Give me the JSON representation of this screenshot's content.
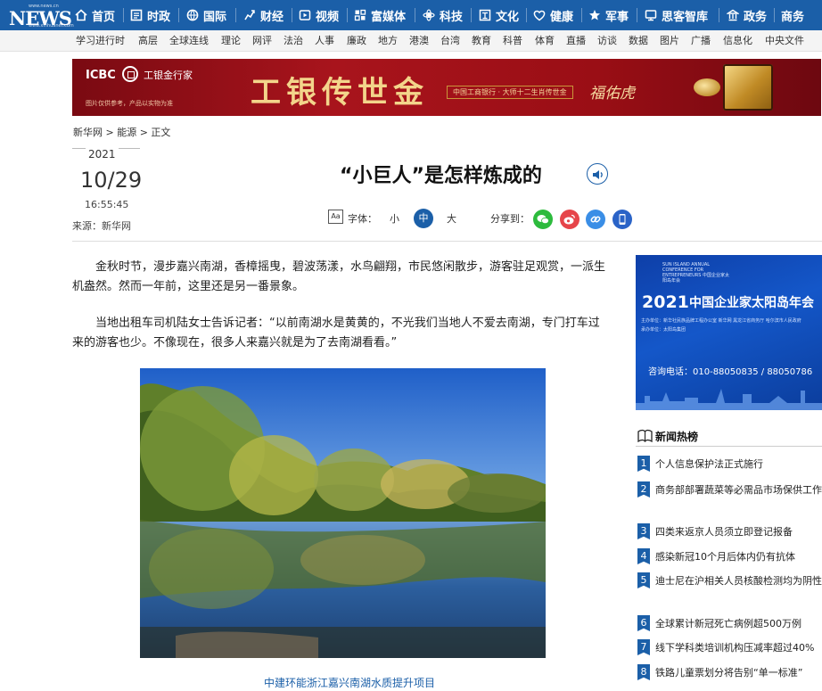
{
  "logo": {
    "latin": "NEWS",
    "cn": "新华网",
    "url": "www.news.cn",
    "url2": "www.xinhuanet.com"
  },
  "topnav": [
    {
      "label": "首页",
      "icon": "home-icon"
    },
    {
      "label": "时政",
      "icon": "politics-icon"
    },
    {
      "label": "国际",
      "icon": "globe-icon"
    },
    {
      "label": "财经",
      "icon": "finance-icon"
    },
    {
      "label": "视频",
      "icon": "video-icon"
    },
    {
      "label": "富媒体",
      "icon": "media-icon"
    },
    {
      "label": "科技",
      "icon": "tech-icon"
    },
    {
      "label": "文化",
      "icon": "culture-icon"
    },
    {
      "label": "健康",
      "icon": "health-icon"
    },
    {
      "label": "军事",
      "icon": "military-icon"
    },
    {
      "label": "思客智库",
      "icon": "thinktank-icon"
    },
    {
      "label": "政务",
      "icon": "government-icon"
    },
    {
      "label": "商务",
      "icon": ""
    }
  ],
  "subnav": [
    "学习进行时",
    "高层",
    "全球连线",
    "理论",
    "网评",
    "法治",
    "人事",
    "廉政",
    "地方",
    "港澳",
    "台湾",
    "教育",
    "科普",
    "体育",
    "直播",
    "访谈",
    "数据",
    "图片",
    "广播",
    "信息化",
    "中央文件"
  ],
  "banner": {
    "icbc": "ICBC",
    "bank": "工银金行家",
    "note": "图片仅供参考，产品以实物为准",
    "headline": "工银传世金",
    "slogan": "中国工商银行 · 大师十二生肖传世金",
    "signature": "福佑虎",
    "colors": {
      "bg": "#a8141c",
      "gold": "#f3d58b"
    }
  },
  "breadcrumb": "新华网 > 能源 > 正文",
  "date": {
    "year": "2021",
    "monthday": "10/29",
    "time": "16:55:45",
    "source": "来源：新华网"
  },
  "article": {
    "title": "“小巨人”是怎样炼成的",
    "fontsize_label": "字体：",
    "size_small": "小",
    "size_medium": "中",
    "size_large": "大",
    "share_label": "分享到：",
    "paragraphs": [
      "金秋时节，漫步嘉兴南湖，香樟摇曳，碧波荡漾，水鸟翩翔，市民悠闲散步，游客驻足观赏，一派生机盎然。然而一年前，这里还是另一番景象。",
      "当地出租车司机陆女士告诉记者：“以前南湖水是黄黄的，不光我们当地人不爱去南湖，专门打车过来的游客也少。不像现在，很多人来嘉兴就是为了去南湖看看。”"
    ],
    "photo_caption": "中建环能浙江嘉兴南湖水质提升项目"
  },
  "share_icons": [
    {
      "name": "wechat-icon",
      "color": "#2dbb3d"
    },
    {
      "name": "weibo-icon",
      "color": "#e6454a"
    },
    {
      "name": "link-icon",
      "color": "#3a8ee6"
    },
    {
      "name": "mobile-icon",
      "color": "#2a63c7"
    }
  ],
  "ad": {
    "small": "SUN ISLAND ANNUAL CONFERENCE FOR ENTREPRENEURS 中国企业家太阳岛年会",
    "year": "2021",
    "title": "中国企业家太阳岛年会",
    "line1": "主办单位：新华社民族品牌工程办公室 新华网 黑龙江省商务厅 哈尔滨市人民政府",
    "line2": "承办单位：太阳岛集团",
    "tel": "咨询电话：010-88050835 / 88050786"
  },
  "hotnews": {
    "title": "新闻热榜",
    "items": [
      {
        "num": "1",
        "text": "个人信息保护法正式施行"
      },
      {
        "num": "2",
        "text": "商务部部署蔬菜等必需品市场保供工作"
      },
      {
        "num": "3",
        "text": "四类来返京人员须立即登记报备"
      },
      {
        "num": "4",
        "text": "感染新冠10个月后体内仍有抗体"
      },
      {
        "num": "5",
        "text": "迪士尼在沪相关人员核酸检测均为阴性"
      },
      {
        "num": "6",
        "text": "全球累计新冠死亡病例超500万例"
      },
      {
        "num": "7",
        "text": "线下学科类培训机构压减率超过40%"
      },
      {
        "num": "8",
        "text": "铁路儿童票划分将告别“单一标准”"
      }
    ]
  }
}
